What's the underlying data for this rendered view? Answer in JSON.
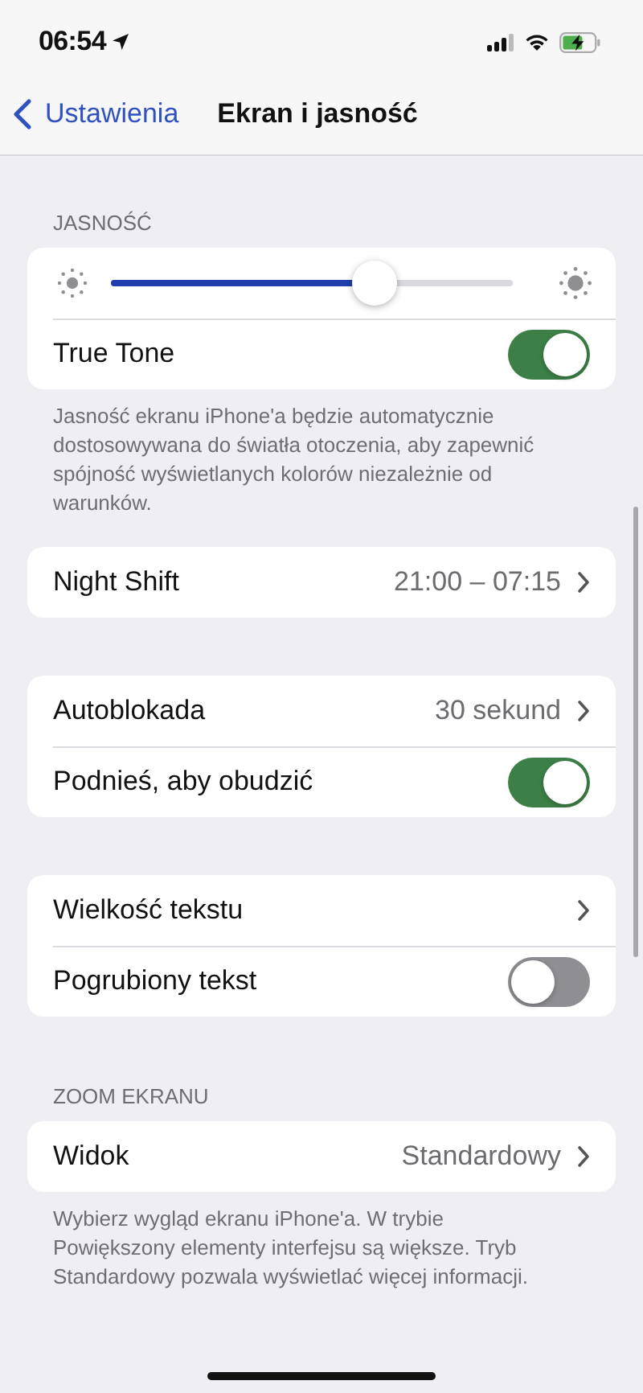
{
  "status_bar": {
    "time": "06:54"
  },
  "nav": {
    "back": "Ustawienia",
    "title": "Ekran i jasność"
  },
  "sections": [
    {
      "header": "JASNOŚĆ",
      "rows": [
        {
          "kind": "slider",
          "level": 0.62
        },
        {
          "kind": "toggle",
          "label": "True Tone",
          "on": true
        }
      ],
      "footer": "Jasność ekranu iPhone'a będzie automatycznie dostosowywana do światła otoczenia, aby zapewnić spójność wyświetlanych kolorów niezależnie od warunków."
    },
    {
      "rows": [
        {
          "kind": "link",
          "label": "Night Shift",
          "value": "21:00 – 07:15"
        }
      ]
    },
    {
      "rows": [
        {
          "kind": "link",
          "label": "Autoblokada",
          "value": "30 sekund"
        },
        {
          "kind": "toggle",
          "label": "Podnieś, aby obudzić",
          "on": true
        }
      ]
    },
    {
      "rows": [
        {
          "kind": "link",
          "label": "Wielkość tekstu"
        },
        {
          "kind": "toggle",
          "label": "Pogrubiony tekst",
          "on": false
        }
      ]
    },
    {
      "header": "ZOOM EKRANU",
      "rows": [
        {
          "kind": "link",
          "label": "Widok",
          "value": "Standardowy"
        }
      ],
      "footer": "Wybierz wygląd ekranu iPhone'a. W trybie Powiększony elementy interfejsu są większe. Tryb Standardowy pozwala wyświetlać więcej informacji."
    }
  ]
}
